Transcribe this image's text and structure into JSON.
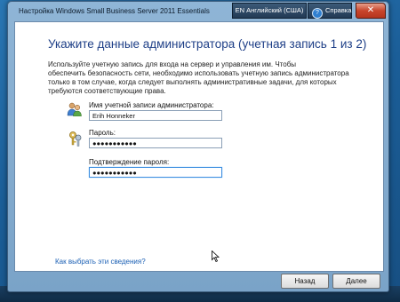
{
  "window": {
    "title": "Настройка Windows Small Business Server 2011 Essentials",
    "language": "EN Английский (США)",
    "help_label": "Справка",
    "help_glyph": "?",
    "close_glyph": "✕"
  },
  "page": {
    "heading": "Укажите данные администратора (учетная запись 1 из 2)",
    "description_lines": [
      "Используйте учетную запись для входа на сервер и управления им. Чтобы",
      "обеспечить безопасность сети, необходимо использовать учетную запись администратора",
      "только в том случае, когда следует выполнять административные задачи, для которых",
      "требуются соответствующие права."
    ]
  },
  "form": {
    "account_label": "Имя учетной записи администратора:",
    "account_value": "Erih Honneker",
    "password_label": "Пароль:",
    "password_value": "●●●●●●●●●●●",
    "confirm_label": "Подтверждение пароля:",
    "confirm_value": "●●●●●●●●●●●"
  },
  "footer": {
    "help_link": "Как выбрать эти сведения?",
    "back_button": "Назад",
    "next_button": "Далее"
  },
  "colors": {
    "heading": "#1e3f87",
    "link": "#1a5fb4",
    "close": "#c8452c"
  },
  "icons": [
    "users-icon",
    "keys-icon",
    "help-icon",
    "close-icon",
    "mouse-cursor-icon"
  ]
}
